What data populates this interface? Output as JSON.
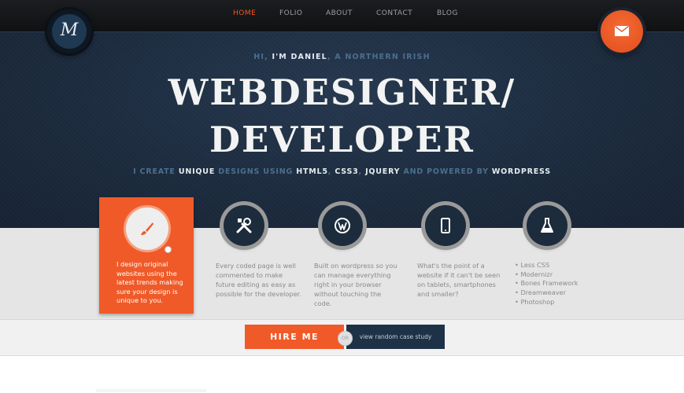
{
  "nav": {
    "items": [
      {
        "label": "HOME",
        "active": true
      },
      {
        "label": "FOLIO"
      },
      {
        "label": "ABOUT"
      },
      {
        "label": "CONTACT"
      },
      {
        "label": "BLOG"
      }
    ]
  },
  "logo": {
    "mark": "M"
  },
  "hero": {
    "intro_prefix": "HI, ",
    "intro_name": "I'M DANIEL",
    "intro_suffix": ", A NORTHERN IRISH",
    "headline_1": "WEBDESIGNER/",
    "headline_2": "DEVELOPER",
    "sub_1": "I CREATE ",
    "sub_2": "UNIQUE",
    "sub_3": " DESIGNS USING ",
    "sub_4": "HTML5",
    "sub_5": ", ",
    "sub_6": "CSS3",
    "sub_7": ", ",
    "sub_8": "JQUERY",
    "sub_9": " AND POWERED BY ",
    "sub_10": "WORDPRESS"
  },
  "features": {
    "design": {
      "icon": "brush-icon",
      "text": "I design original websites using the latest trends making sure your design is unique to you."
    },
    "coding": {
      "icon": "tools-icon",
      "text": "Every coded page is well commented to make future editing as easy as possible for the developer."
    },
    "wordpress": {
      "icon": "wordpress-icon",
      "text": "Built on wordpress so you can manage everything right in your browser without touching the code."
    },
    "mobile": {
      "icon": "phone-icon",
      "text": "What's the point of a website if it can't be seen on tablets, smartphones and smaller?"
    },
    "tools": {
      "icon": "flask-icon",
      "items": [
        "Less CSS",
        "Modernizr",
        "Bones Framework",
        "Dreamweaver",
        "Photoshop"
      ]
    }
  },
  "cta": {
    "hire_label": "HIRE ME",
    "or_label": "OR",
    "case_label": "view random case study"
  },
  "colors": {
    "accent": "#f05a28",
    "hero_bg": "#1c2b3e",
    "dark_button": "#1e3247"
  }
}
